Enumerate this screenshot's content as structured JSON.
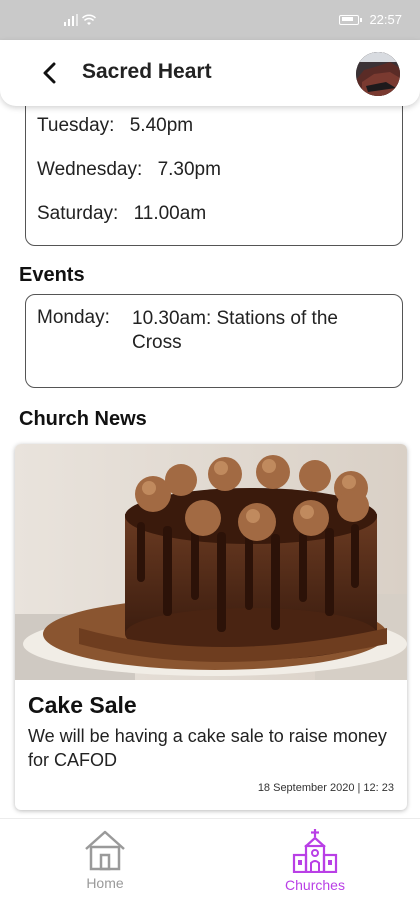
{
  "status_bar": {
    "time": "22:57"
  },
  "header": {
    "title": "Sacred Heart"
  },
  "mass_times": [
    {
      "day": "Tuesday:",
      "time": "5.40pm"
    },
    {
      "day": "Wednesday:",
      "time": "7.30pm"
    },
    {
      "day": "Saturday:",
      "time": "11.00am"
    }
  ],
  "events": {
    "title": "Events",
    "items": [
      {
        "day": "Monday:",
        "text": "10.30am: Stations of the Cross"
      }
    ]
  },
  "news": {
    "title": "Church News",
    "items": [
      {
        "title": "Cake Sale",
        "body": "We will be having a cake sale to raise money for CAFOD",
        "date": "18 September 2020 | 12: 23"
      }
    ]
  },
  "bottom_nav": {
    "items": [
      {
        "label": "Home",
        "icon": "house-icon",
        "active": false
      },
      {
        "label": "Churches",
        "icon": "church-icon",
        "active": true
      }
    ],
    "active_color": "#b93fe6",
    "inactive_color": "#9a9a9a"
  }
}
